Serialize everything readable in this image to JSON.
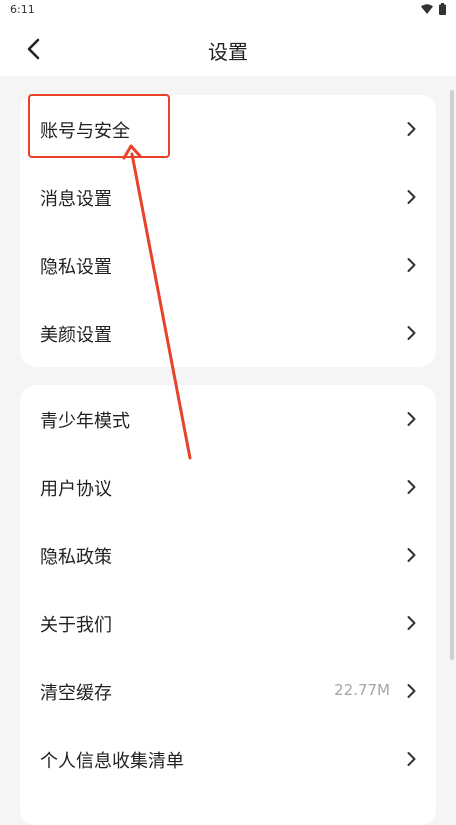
{
  "status_bar": {
    "time": "6:11",
    "wifi_icon": "wifi-icon",
    "battery_icon": "battery-icon"
  },
  "header": {
    "title": "设置",
    "back_icon": "back-arrow-icon"
  },
  "group1": [
    {
      "label": "账号与安全"
    },
    {
      "label": "消息设置"
    },
    {
      "label": "隐私设置"
    },
    {
      "label": "美颜设置"
    }
  ],
  "group2": [
    {
      "label": "青少年模式"
    },
    {
      "label": "用户协议"
    },
    {
      "label": "隐私政策"
    },
    {
      "label": "关于我们"
    },
    {
      "label": "清空缓存",
      "value": "22.77M"
    },
    {
      "label": "个人信息收集清单"
    }
  ],
  "colors": {
    "accent": "#e8422b",
    "background": "#f5f5f5",
    "card": "#ffffff",
    "muted": "#a5a5a5"
  }
}
